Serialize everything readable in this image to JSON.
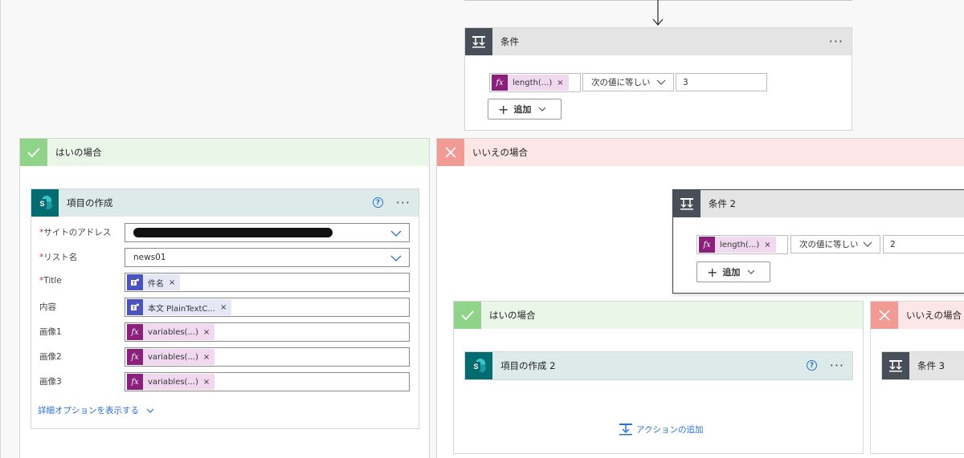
{
  "colors": {
    "accent": "#2b6fd6",
    "fx_token": "#8a1f7e",
    "teams_token": "#4b53bc",
    "sharepoint": "#036c70",
    "yes_icon": "#90d48a",
    "no_icon": "#f29a94",
    "condition_icon": "#484f58"
  },
  "condition1": {
    "title": "条件",
    "token": "length(...)",
    "operator": "次の値に等しい",
    "value": "3",
    "add_label": "追加"
  },
  "yes_branch": {
    "title": "はいの場合",
    "action": {
      "title": "項目の作成",
      "fields": [
        {
          "label": "サイトのアドレス",
          "required": "*",
          "value": ""
        },
        {
          "label": "リスト名",
          "required": "*",
          "value": "news01"
        },
        {
          "label": "Title",
          "required": "*",
          "token": "件名"
        },
        {
          "label": "内容",
          "required": "",
          "token": "本文 PlainTextC..."
        },
        {
          "label": "画像1",
          "required": "",
          "token": "variables(...)"
        },
        {
          "label": "画像2",
          "required": "",
          "token": "variables(...)"
        },
        {
          "label": "画像3",
          "required": "",
          "token": "variables(...)"
        }
      ],
      "advanced_link": "詳細オプションを表示する",
      "help": "?"
    }
  },
  "no_branch": {
    "title": "いいえの場合",
    "condition2": {
      "title": "条件 2",
      "token": "length(...)",
      "operator": "次の値に等しい",
      "value": "2",
      "add_label": "追加"
    },
    "inner_yes": {
      "title": "はいの場合",
      "action_title": "項目の作成 2",
      "help": "?",
      "add_action_label": "アクションの追加"
    },
    "inner_no": {
      "title": "いいえの場合",
      "condition_title": "条件 3"
    }
  },
  "menu_dots": "···"
}
